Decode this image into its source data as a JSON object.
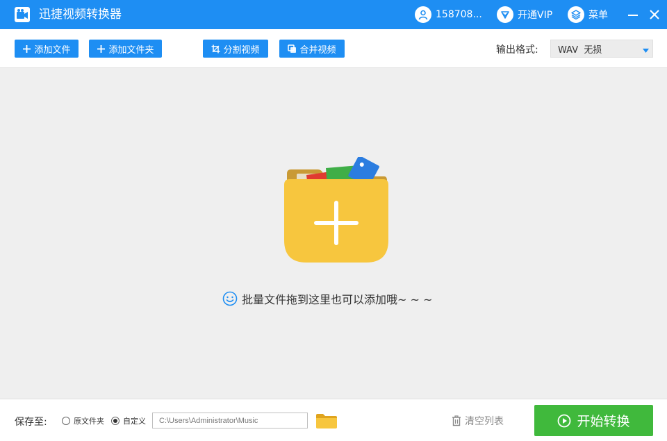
{
  "titlebar": {
    "app_title": "迅捷视频转换器",
    "user_label": "158708...",
    "vip_label": "开通VIP",
    "menu_label": "菜单"
  },
  "toolbar": {
    "add_file": "添加文件",
    "add_folder": "添加文件夹",
    "split_video": "分割视频",
    "merge_video": "合并视频",
    "format_label": "输出格式:",
    "format_value": "WAV  无损"
  },
  "drop_area": {
    "hint": "批量文件拖到这里也可以添加哦~ ~ ~"
  },
  "bottombar": {
    "save_label": "保存至:",
    "radio_original": "原文件夹",
    "radio_custom": "自定义",
    "path_value": "C:\\Users\\Administrator\\Music",
    "clear_list": "清空列表",
    "start_convert": "开始转换"
  },
  "colors": {
    "accent": "#1e8ef3",
    "start_green": "#40b93c",
    "folder_yellow": "#f7c63e"
  }
}
